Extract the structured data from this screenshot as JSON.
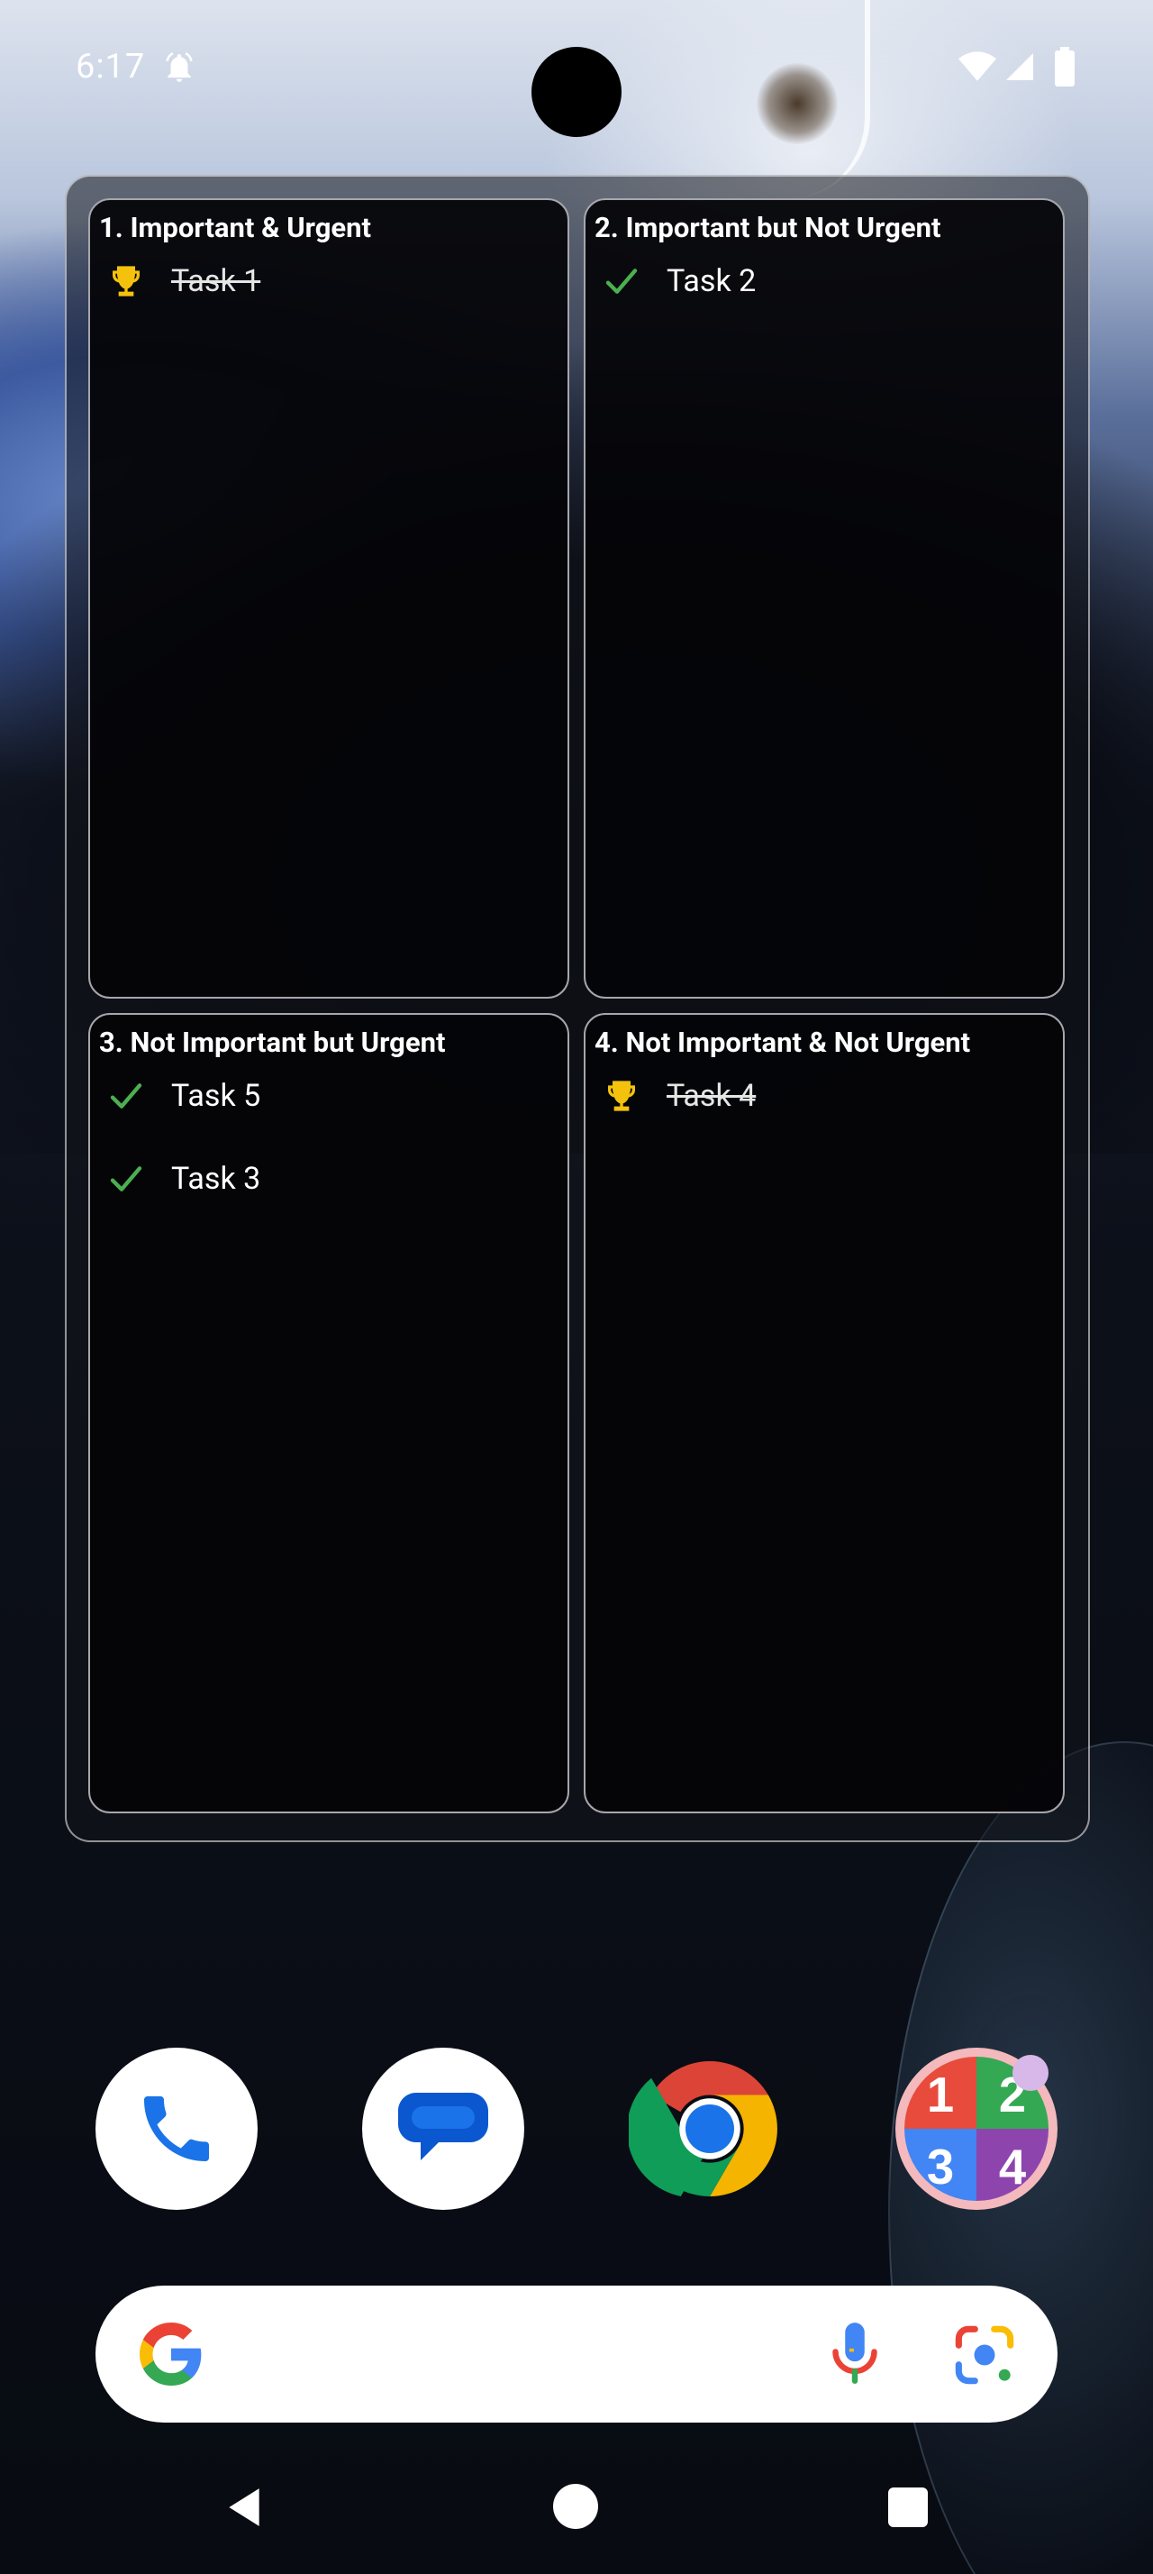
{
  "status_bar": {
    "time": "6:17",
    "icons": [
      "alarm-icon",
      "wifi-icon",
      "signal-icon",
      "battery-icon"
    ]
  },
  "widget": {
    "quadrants": [
      {
        "title": "1. Important & Urgent",
        "tasks": [
          {
            "label": "Task 1",
            "icon": "trophy-icon",
            "completed": true
          }
        ]
      },
      {
        "title": "2. Important but Not Urgent",
        "tasks": [
          {
            "label": "Task 2",
            "icon": "check-icon",
            "completed": false
          }
        ]
      },
      {
        "title": "3. Not Important but Urgent",
        "tasks": [
          {
            "label": "Task 5",
            "icon": "check-icon",
            "completed": false
          },
          {
            "label": "Task 3",
            "icon": "check-icon",
            "completed": false
          }
        ]
      },
      {
        "title": "4. Not Important & Not Urgent",
        "tasks": [
          {
            "label": "Task 4",
            "icon": "trophy-icon",
            "completed": true
          }
        ]
      }
    ]
  },
  "dock": {
    "apps": [
      {
        "name": "Phone",
        "icon": "phone-icon"
      },
      {
        "name": "Messages",
        "icon": "messages-icon"
      },
      {
        "name": "Chrome",
        "icon": "chrome-icon"
      },
      {
        "name": "Eisenhower Matrix",
        "icon": "matrix-app-icon",
        "digits": [
          "1",
          "2",
          "3",
          "4"
        ]
      }
    ]
  },
  "search_bar": {
    "icons": [
      "google-g-icon",
      "microphone-icon",
      "lens-camera-icon"
    ]
  },
  "colors": {
    "check_green": "#4caf50",
    "trophy_gold": "#f4c20d",
    "quadrant_border": "#a6a6ad",
    "matrix_red": "#e84b3c",
    "matrix_green": "#34a853",
    "matrix_blue": "#4285f4",
    "matrix_purple": "#8e44ad"
  }
}
